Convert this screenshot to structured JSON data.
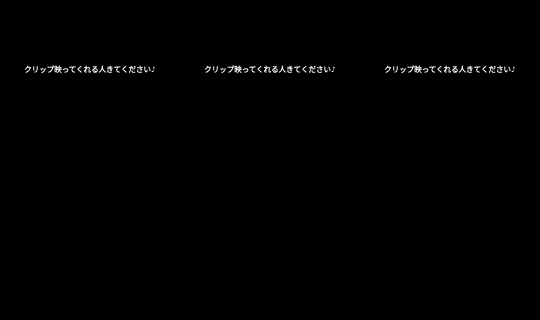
{
  "panels": [
    {
      "caption": "クリップ映ってくれる人きてください♪"
    },
    {
      "caption": "クリップ映ってくれる人きてください♪"
    },
    {
      "caption": "クリップ映ってくれる人きてください♪"
    }
  ],
  "colors": {
    "background": "#000000",
    "text": "#ffffff"
  }
}
